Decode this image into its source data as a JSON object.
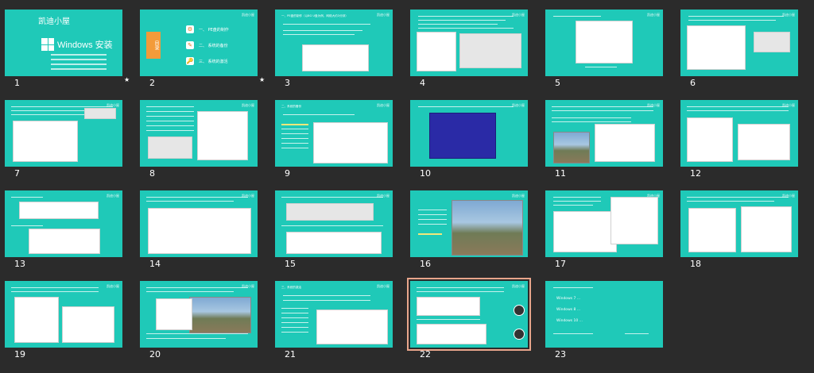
{
  "slides": [
    {
      "num": "1",
      "title": "",
      "star": "★",
      "cover": {
        "logo": "凯迪小屋",
        "title": "Windows 安装"
      }
    },
    {
      "num": "2",
      "title": "",
      "star": "★",
      "toc": {
        "label": "目录",
        "items": [
          "一、 PE盘的制作",
          "二、 系统的备份",
          "三、 系统的激活"
        ]
      }
    },
    {
      "num": "3",
      "title": "一、PE盘的制作（以8G U盘为例，网络大约3分钟）"
    },
    {
      "num": "4",
      "title": ""
    },
    {
      "num": "5",
      "title": ""
    },
    {
      "num": "6",
      "title": ""
    },
    {
      "num": "7",
      "title": ""
    },
    {
      "num": "8",
      "title": ""
    },
    {
      "num": "9",
      "title": "二、系统的备份"
    },
    {
      "num": "10",
      "title": ""
    },
    {
      "num": "11",
      "title": ""
    },
    {
      "num": "12",
      "title": ""
    },
    {
      "num": "13",
      "title": ""
    },
    {
      "num": "14",
      "title": ""
    },
    {
      "num": "15",
      "title": ""
    },
    {
      "num": "16",
      "title": ""
    },
    {
      "num": "17",
      "title": ""
    },
    {
      "num": "18",
      "title": ""
    },
    {
      "num": "19",
      "title": ""
    },
    {
      "num": "20",
      "title": ""
    },
    {
      "num": "21",
      "title": "三、系统的激活"
    },
    {
      "num": "22",
      "title": "",
      "selected": true
    },
    {
      "num": "23",
      "title": "",
      "os_list": [
        "Windows 7 ...",
        "Windows 8 ...",
        "Windows 10 ..."
      ]
    }
  ],
  "brand_label": "凯迪小屋",
  "colors": {
    "slide_bg": "#1fc9b8",
    "workspace_bg": "#2b2b2b",
    "selection": "#e8a58b",
    "toc_orange": "#f39b3a"
  }
}
